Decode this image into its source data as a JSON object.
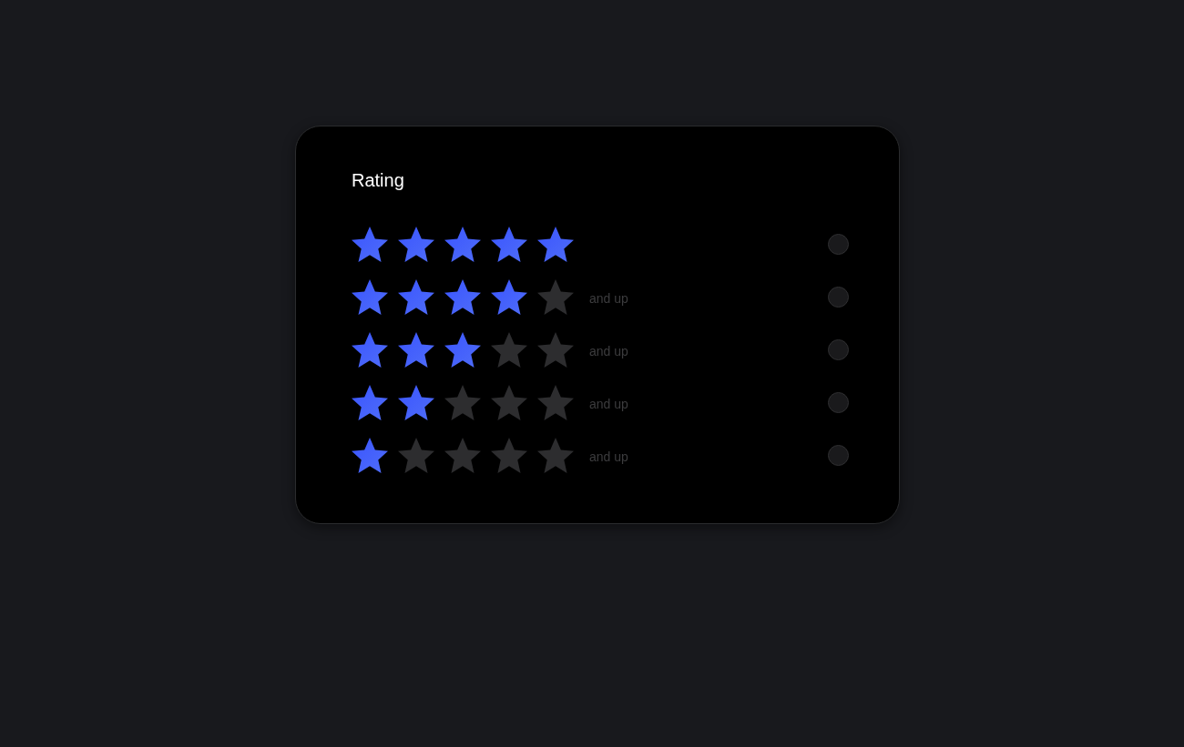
{
  "filter": {
    "title": "Rating",
    "options": [
      {
        "stars": 5,
        "selected": false
      },
      {
        "stars": 4,
        "label": "and up",
        "selected": false
      },
      {
        "stars": 3,
        "label": "and up",
        "selected": false
      },
      {
        "stars": 2,
        "label": "and up",
        "selected": false
      },
      {
        "stars": 1,
        "label": "and up",
        "selected": false
      }
    ]
  }
}
